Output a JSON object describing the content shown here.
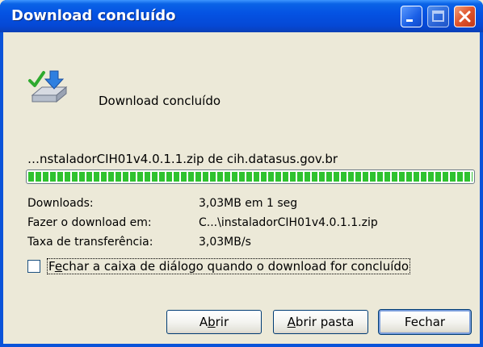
{
  "window": {
    "title": "Download concluído",
    "controls": {
      "minimize": "minimize-icon",
      "maximize": "maximize-icon",
      "close": "close-icon"
    }
  },
  "header": {
    "icon": "download-complete-icon",
    "text": "Download concluído"
  },
  "source_line": "…nstaladorCIH01v4.0.1.1.zip de cih.datasus.gov.br",
  "progress": {
    "fraction": 1.0,
    "color": "#2fc22f"
  },
  "details": [
    {
      "label": "Downloads:",
      "value": "3,03MB em 1 seg"
    },
    {
      "label": "Fazer o download em:",
      "value": "C...\\instaladorCIH01v4.0.1.1.zip"
    },
    {
      "label": "Taxa de transferência:",
      "value": "3,03MB/s"
    }
  ],
  "close_on_complete": {
    "checked": false,
    "label_pre": "F",
    "label_key": "e",
    "label_post": "char a caixa de diálogo quando o download for concluído"
  },
  "buttons": {
    "open": {
      "pre": "A",
      "key": "b",
      "post": "rir"
    },
    "open_folder": {
      "pre": "",
      "key": "A",
      "post": "brir pasta"
    },
    "close": {
      "label": "Fechar"
    }
  },
  "colors": {
    "titlebar": "#0553e3",
    "dialog_bg": "#ece9d8",
    "close_button": "#e0532b"
  }
}
